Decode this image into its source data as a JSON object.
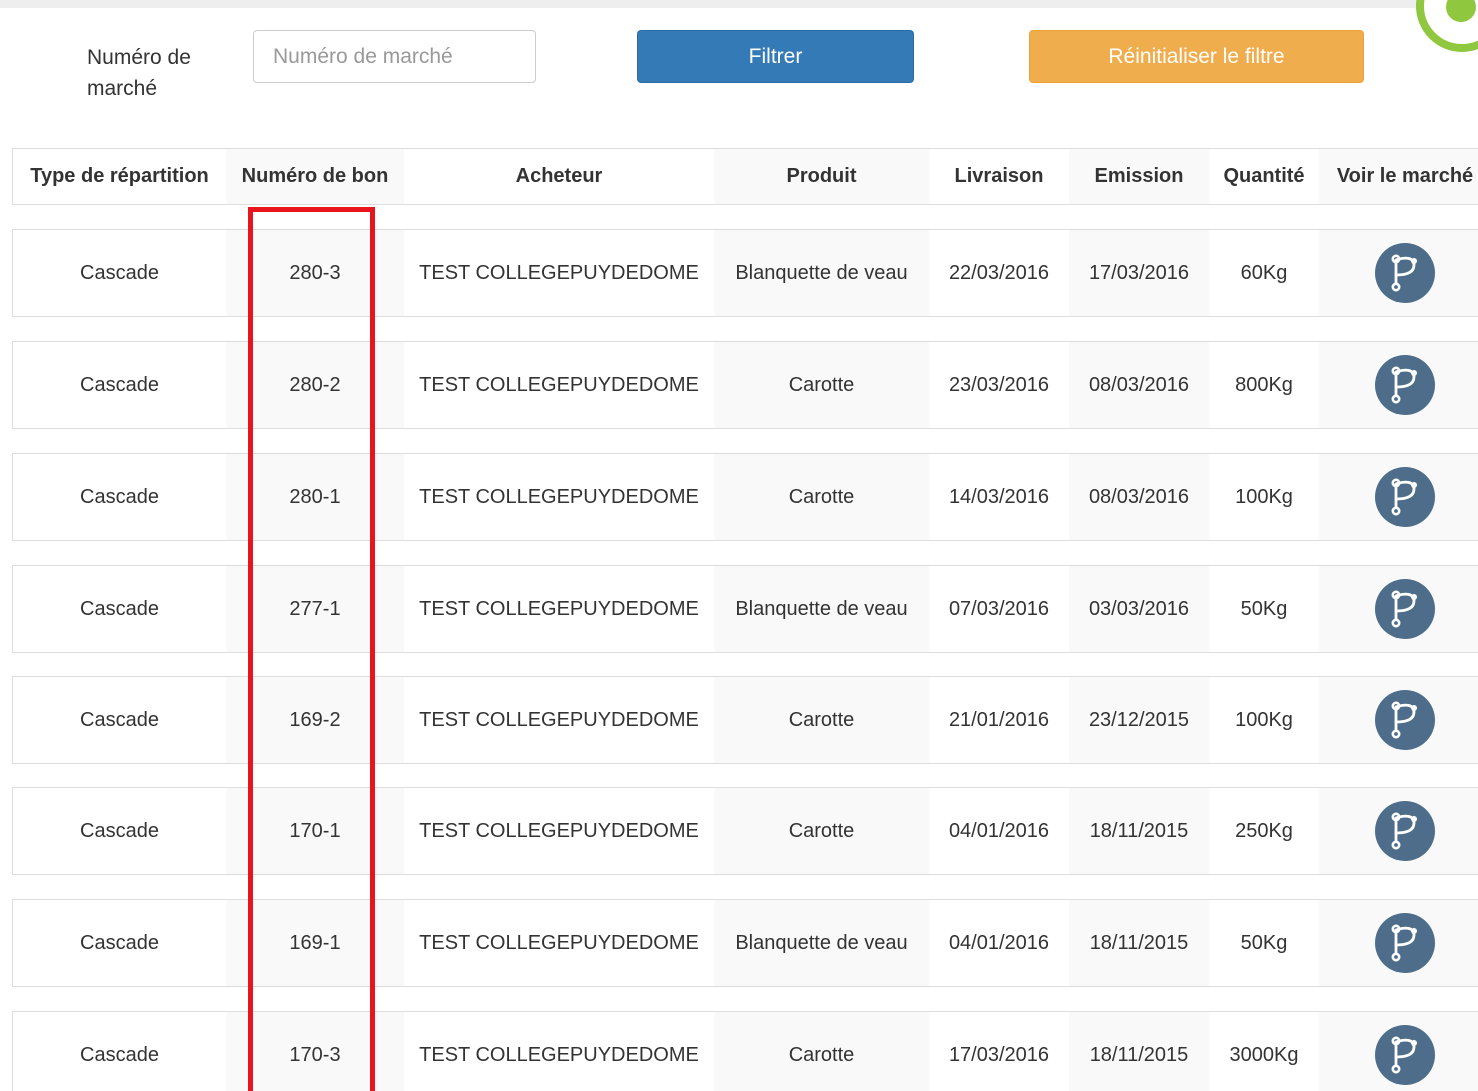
{
  "filter": {
    "label": "Numéro de marché",
    "input_value": "",
    "input_placeholder": "Numéro de marché",
    "filter_button": "Filtrer",
    "reset_button": "Réinitialiser le filtre"
  },
  "table": {
    "headers": [
      "Type de répartition",
      "Numéro de bon",
      "Acheteur",
      "Produit",
      "Livraison",
      "Emission",
      "Quantité",
      "Voir le marché"
    ],
    "rows": [
      {
        "type": "Cascade",
        "bon": "280-3",
        "acheteur": "TEST COLLEGEPUYDEDOME",
        "produit": "Blanquette de veau",
        "livraison": "22/03/2016",
        "emission": "17/03/2016",
        "quantite": "60Kg",
        "icon": "branch-icon"
      },
      {
        "type": "Cascade",
        "bon": "280-2",
        "acheteur": "TEST COLLEGEPUYDEDOME",
        "produit": "Carotte",
        "livraison": "23/03/2016",
        "emission": "08/03/2016",
        "quantite": "800Kg",
        "icon": "branch-icon"
      },
      {
        "type": "Cascade",
        "bon": "280-1",
        "acheteur": "TEST COLLEGEPUYDEDOME",
        "produit": "Carotte",
        "livraison": "14/03/2016",
        "emission": "08/03/2016",
        "quantite": "100Kg",
        "icon": "branch-icon"
      },
      {
        "type": "Cascade",
        "bon": "277-1",
        "acheteur": "TEST COLLEGEPUYDEDOME",
        "produit": "Blanquette de veau",
        "livraison": "07/03/2016",
        "emission": "03/03/2016",
        "quantite": "50Kg",
        "icon": "branch-icon"
      },
      {
        "type": "Cascade",
        "bon": "169-2",
        "acheteur": "TEST COLLEGEPUYDEDOME",
        "produit": "Carotte",
        "livraison": "21/01/2016",
        "emission": "23/12/2015",
        "quantite": "100Kg",
        "icon": "branch-icon"
      },
      {
        "type": "Cascade",
        "bon": "170-1",
        "acheteur": "TEST COLLEGEPUYDEDOME",
        "produit": "Carotte",
        "livraison": "04/01/2016",
        "emission": "18/11/2015",
        "quantite": "250Kg",
        "icon": "branch-icon"
      },
      {
        "type": "Cascade",
        "bon": "169-1",
        "acheteur": "TEST COLLEGEPUYDEDOME",
        "produit": "Blanquette de veau",
        "livraison": "04/01/2016",
        "emission": "18/11/2015",
        "quantite": "50Kg",
        "icon": "branch-icon"
      },
      {
        "type": "Cascade",
        "bon": "170-3",
        "acheteur": "TEST COLLEGEPUYDEDOME",
        "produit": "Carotte",
        "livraison": "17/03/2016",
        "emission": "18/11/2015",
        "quantite": "3000Kg",
        "icon": "branch-icon"
      }
    ]
  },
  "colors": {
    "filter_button": "#337ab7",
    "reset_button": "#f0ad4e",
    "icon_circle": "#4d6d8a",
    "highlight": "#e8141e",
    "logo": "#8fc73e"
  }
}
